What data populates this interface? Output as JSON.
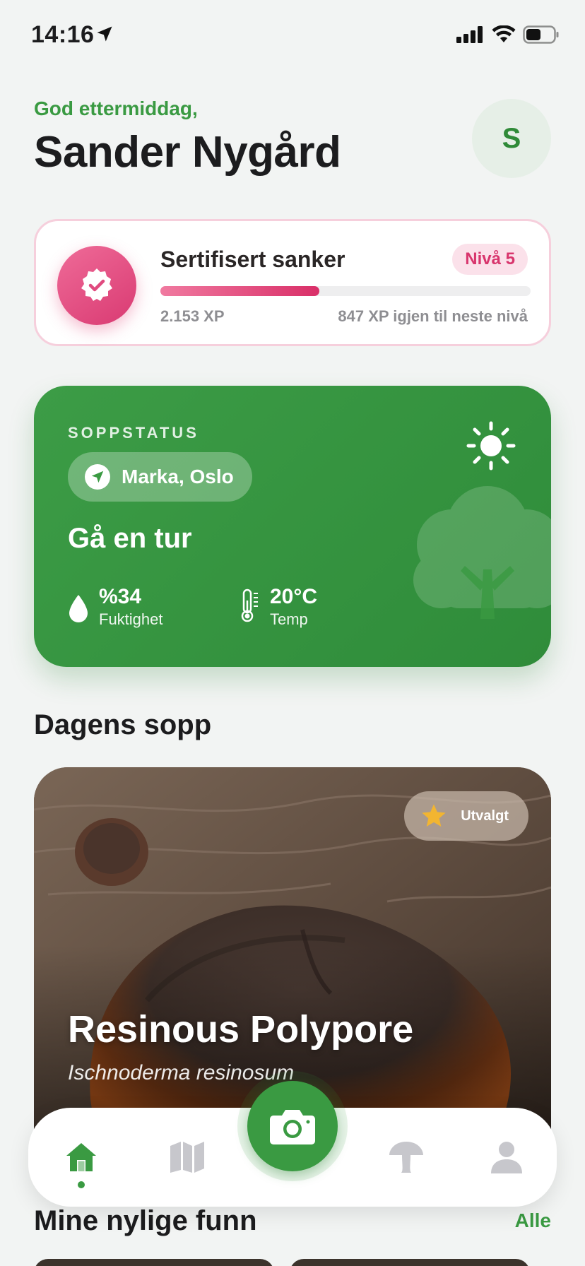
{
  "status_bar": {
    "time": "14:16"
  },
  "header": {
    "greeting": "God ettermiddag,",
    "user_name": "Sander Nygård",
    "avatar_initial": "S"
  },
  "level_card": {
    "title": "Sertifisert sanker",
    "level_label": "Nivå 5",
    "xp_current": "2.153 XP",
    "xp_remaining": "847 XP igjen til neste nivå",
    "progress_fraction": 0.43,
    "accent_color": "#d93a72"
  },
  "status_card": {
    "eyebrow": "SOPPSTATUS",
    "location": "Marka, Oslo",
    "advice": "Gå en tur",
    "humidity_value": "%34",
    "humidity_label": "Fuktighet",
    "temp_value": "20°C",
    "temp_label": "Temp",
    "weather_icon": "sun-icon",
    "background_color": "#3a9a42"
  },
  "daily_mushroom": {
    "section_title": "Dagens sopp",
    "badge": "Utvalgt",
    "name": "Resinous Polypore",
    "latin_name": "Ischnoderma resinosum"
  },
  "tab_bar": {
    "items": [
      {
        "name": "home",
        "icon": "home-icon",
        "active": true
      },
      {
        "name": "map",
        "icon": "map-icon",
        "active": false
      },
      {
        "name": "camera",
        "icon": "camera-icon",
        "active": false
      },
      {
        "name": "mushrooms",
        "icon": "mushroom-icon",
        "active": false
      },
      {
        "name": "profile",
        "icon": "person-icon",
        "active": false
      }
    ],
    "active_color": "#3a9a42",
    "inactive_color": "#c7c7cc"
  },
  "recent": {
    "title": "Mine nylige funn",
    "see_all": "Alle"
  }
}
